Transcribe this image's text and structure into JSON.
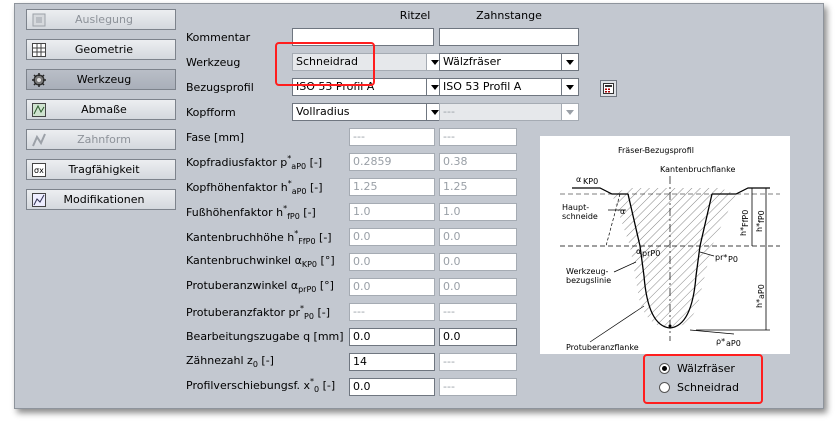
{
  "nav": [
    {
      "label": "Auslegung",
      "icon": "design-icon",
      "state": "disabled"
    },
    {
      "label": "Geometrie",
      "icon": "grid-icon",
      "state": "normal"
    },
    {
      "label": "Werkzeug",
      "icon": "tool-gear-icon",
      "state": "active"
    },
    {
      "label": "Abmaße",
      "icon": "dimensions-icon",
      "state": "normal"
    },
    {
      "label": "Zahnform",
      "icon": "tooth-form-icon",
      "state": "disabled"
    },
    {
      "label": "Tragfähigkeit",
      "icon": "load-capacity-icon",
      "state": "normal"
    },
    {
      "label": "Modifikationen",
      "icon": "modification-icon",
      "state": "normal"
    }
  ],
  "columns": {
    "ritzel": "Ritzel",
    "zahnstange": "Zahnstange"
  },
  "labels": {
    "kommentar": "Kommentar",
    "werkzeug": "Werkzeug",
    "bezugsprofil": "Bezugsprofil",
    "kopfform": "Kopfform",
    "fase": "Fase [mm]",
    "kopfradius": "Kopfradiusfaktor p",
    "kopfhoehe": "Kopfhöhenfaktor h",
    "fusshoehe": "Fußhöhenfaktor h",
    "kantenbruchhoehe": "Kantenbruchhöhe h",
    "kantenbruchwinkel": "Kantenbruchwinkel α",
    "protuberanzwinkel": "Protuberanzwinkel α",
    "protuberanzfaktor": "Protuberanzfaktor pr",
    "bearbeitungszugabe": "Bearbeitungszugabe q [mm]",
    "zaehnezahl": "Zähnezahl z",
    "profilverschiebung": "Profilverschiebungsf. x"
  },
  "ritzel": {
    "kommentar": "",
    "werkzeug": "Schneidrad",
    "bezugsprofil": "ISO 53 Profil A",
    "kopfform": "Vollradius",
    "fase": "---",
    "kopfradius": "0.2859",
    "kopfhoehe": "1.25",
    "fusshoehe": "1.0",
    "kantenbruchhoehe": "0.0",
    "kantenbruchwinkel": "0.0",
    "protuberanzwinkel": "0.0",
    "protuberanzfaktor": "---",
    "bearbeitungszugabe": "0.0",
    "zaehnezahl": "14",
    "profilverschiebung": "0.0"
  },
  "zahnstange": {
    "kommentar": "",
    "werkzeug": "Wälzfräser",
    "bezugsprofil": "ISO 53 Profil A",
    "kopfform": "---",
    "fase": "---",
    "kopfradius": "0.38",
    "kopfhoehe": "1.25",
    "fusshoehe": "1.0",
    "kantenbruchhoehe": "0.0",
    "kantenbruchwinkel": "0.0",
    "protuberanzwinkel": "0.0",
    "protuberanzfaktor": "---",
    "bearbeitungszugabe": "0.0",
    "zaehnezahl": "---",
    "profilverschiebung": "---"
  },
  "diagram": {
    "title": "Fräser-Bezugsprofil",
    "kantenbruchflanke": "Kantenbruchflanke",
    "hauptschneide": "Haupt-",
    "hauptschneide2": "schneide",
    "werkzeugbezug": "Werkzeug-",
    "werkzeugbezug2": "bezugslinie",
    "protuberanzflanke": "Protuberanzflanke",
    "alpha_kpo": "α",
    "alpha": "α",
    "alpha_prpo": "α",
    "pr_po": "pr*",
    "rho_apo": "ρ*",
    "h_fpo": "h*",
    "h_ffpo": "h*",
    "h_apo": "h*"
  },
  "radio": {
    "option1": "Wälzfräser",
    "option2": "Schneidrad",
    "selected": "option1"
  },
  "colors": {
    "highlight": "#ff1e1e",
    "panel": "#c3c8d0"
  }
}
